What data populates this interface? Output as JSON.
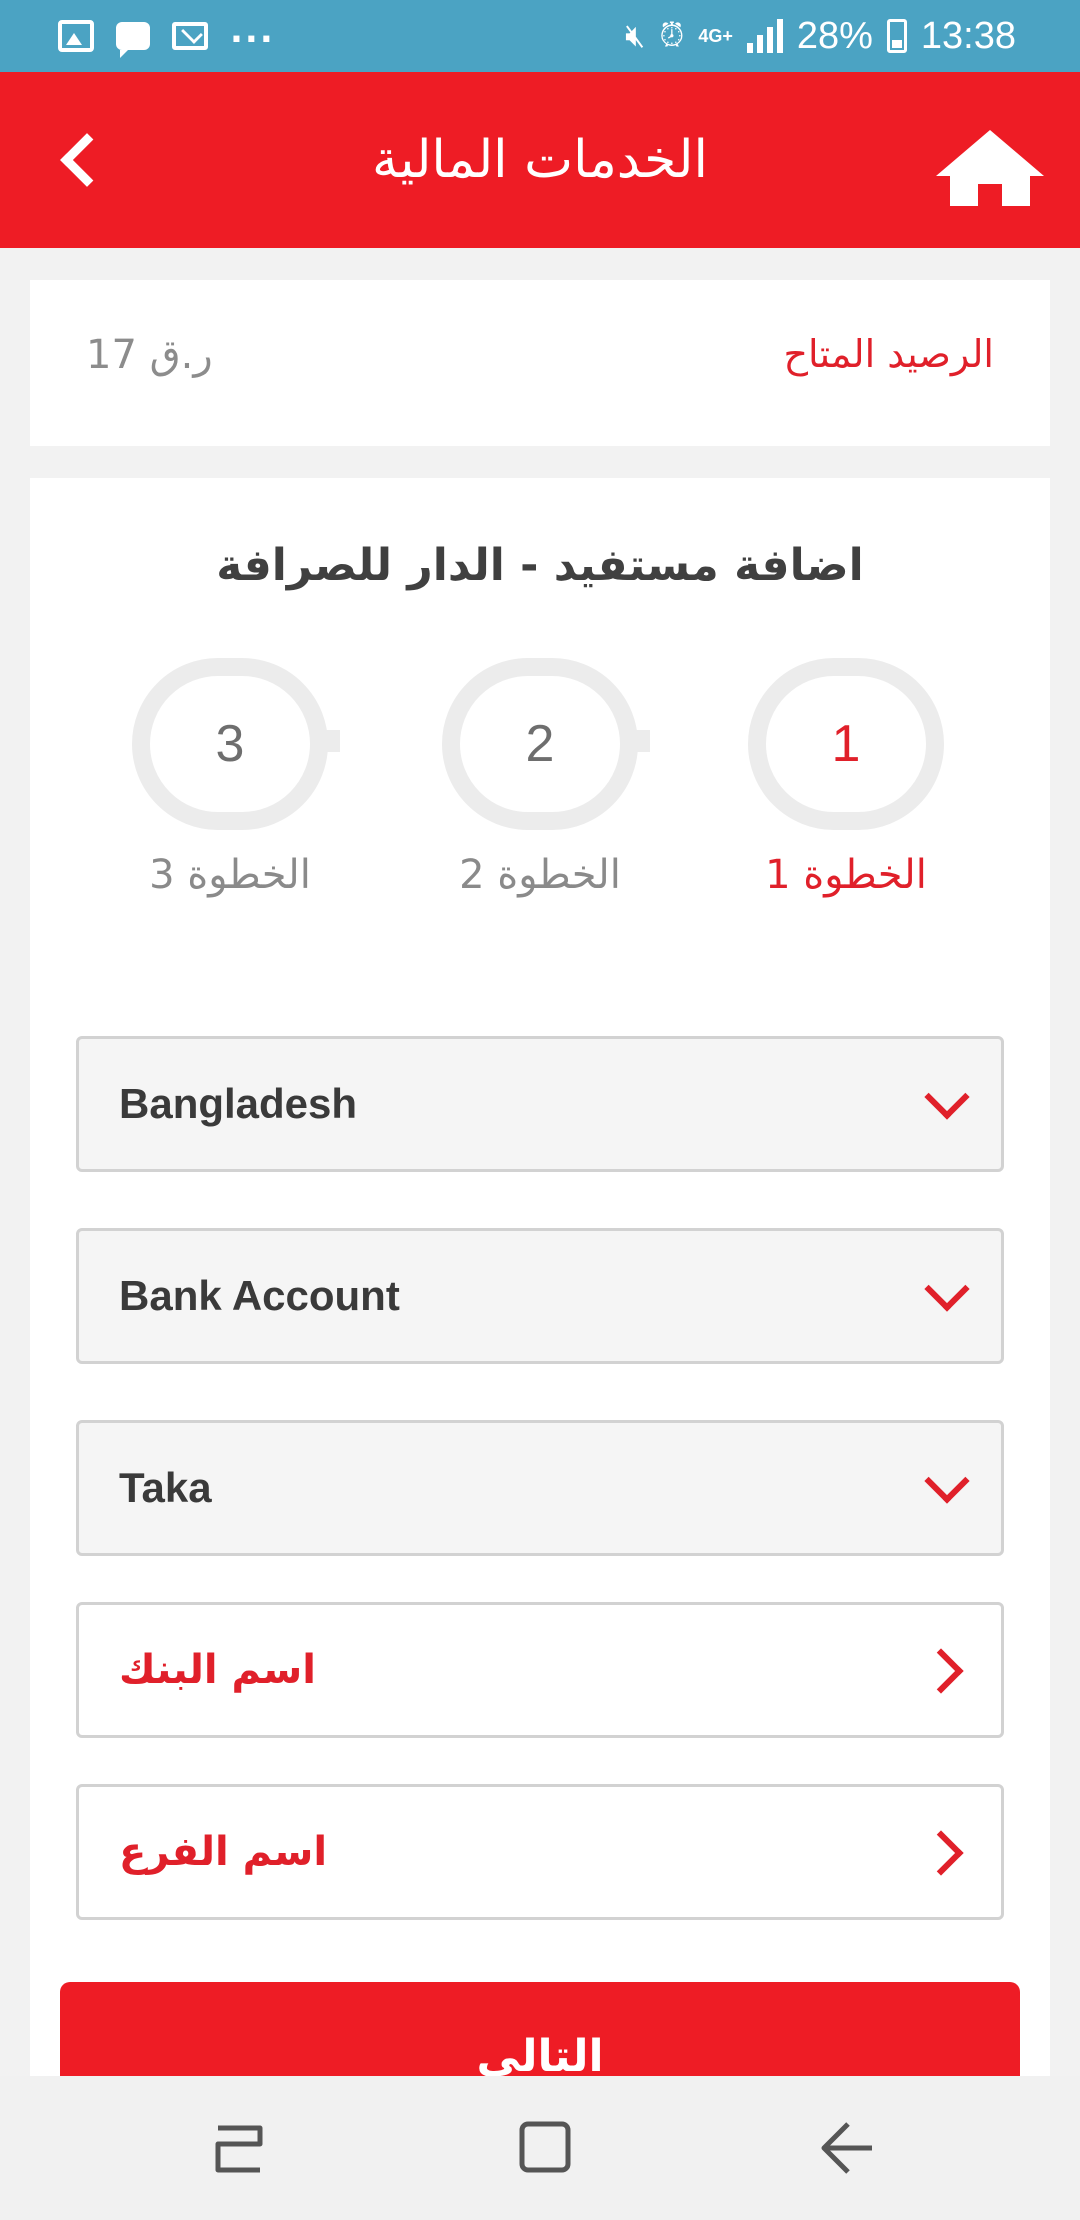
{
  "status_bar": {
    "battery": "28%",
    "time": "13:38",
    "network": "4G+",
    "overflow": "..."
  },
  "header": {
    "title": "الخدمات المالية"
  },
  "balance": {
    "label": "الرصيد المتاح",
    "value": "ر.ق 17"
  },
  "form": {
    "title": "اضافة مستفيد - الدار للصرافة",
    "steps": [
      {
        "number": "1",
        "label": "الخطوة 1",
        "active": true
      },
      {
        "number": "2",
        "label": "الخطوة 2",
        "active": false
      },
      {
        "number": "3",
        "label": "الخطوة 3",
        "active": false
      }
    ],
    "country": "Bangladesh",
    "transfer_type": "Bank Account",
    "currency": "Taka",
    "bank_name_label": "اسم البنك",
    "branch_name_label": "اسم الفرع",
    "next_label": "التالي"
  },
  "colors": {
    "brand_red": "#ee1c25",
    "status_bar": "#4ba3c3",
    "accent_text": "#e0202a"
  },
  "icons": [
    "image-icon",
    "chat-icon",
    "mail-icon",
    "mute-icon",
    "alarm-icon",
    "signal-icon",
    "battery-icon",
    "back-chevron-icon",
    "home-icon",
    "chevron-down-icon",
    "chevron-right-icon",
    "recent-apps-icon",
    "home-square-icon",
    "back-arrow-icon"
  ]
}
